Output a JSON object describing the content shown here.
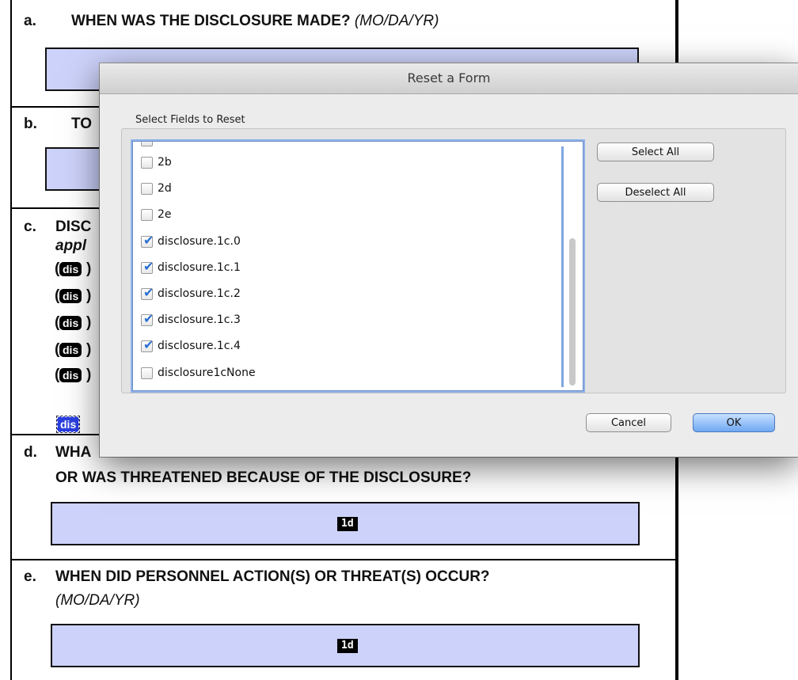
{
  "form": {
    "q_a_letter": "a.",
    "q_a_text": "WHEN WAS THE DISCLOSURE MADE?",
    "q_a_format": "(MO/DA/YR)",
    "q_b_letter": "b.",
    "q_b_text": "TO",
    "q_c_letter": "c.",
    "q_c_text": "DISC",
    "q_c_line2": "appl",
    "dis_tag": "dis",
    "paren_open": "(",
    "paren_close": ")",
    "q_d_letter": "d.",
    "q_d_text": "WHA",
    "q_d_line2": "OR WAS THREATENED BECAUSE OF THE DISCLOSURE?",
    "q_d_field_tag": "1d",
    "q_e_letter": "e.",
    "q_e_text": "WHEN DID PERSONNEL ACTION(S) OR THREAT(S) OCCUR?",
    "q_e_format": "(MO/DA/YR)",
    "q_e_field_tag": "1d"
  },
  "dialog": {
    "title": "Reset a Form",
    "group_label": "Select Fields to Reset",
    "fields": [
      {
        "label": "2b",
        "checked": false
      },
      {
        "label": "2d",
        "checked": false
      },
      {
        "label": "2e",
        "checked": false
      },
      {
        "label": "disclosure.1c.0",
        "checked": true
      },
      {
        "label": "disclosure.1c.1",
        "checked": true
      },
      {
        "label": "disclosure.1c.2",
        "checked": true
      },
      {
        "label": "disclosure.1c.3",
        "checked": true
      },
      {
        "label": "disclosure.1c.4",
        "checked": true
      },
      {
        "label": "disclosure1cNone",
        "checked": false
      }
    ],
    "select_all_label": "Select All",
    "deselect_all_label": "Deselect All",
    "cancel_label": "Cancel",
    "ok_label": "OK"
  },
  "colors": {
    "field_fill": "#cdd2fa",
    "ok_button": "#6fa8f2",
    "checkmark": "#2a6fcf"
  }
}
